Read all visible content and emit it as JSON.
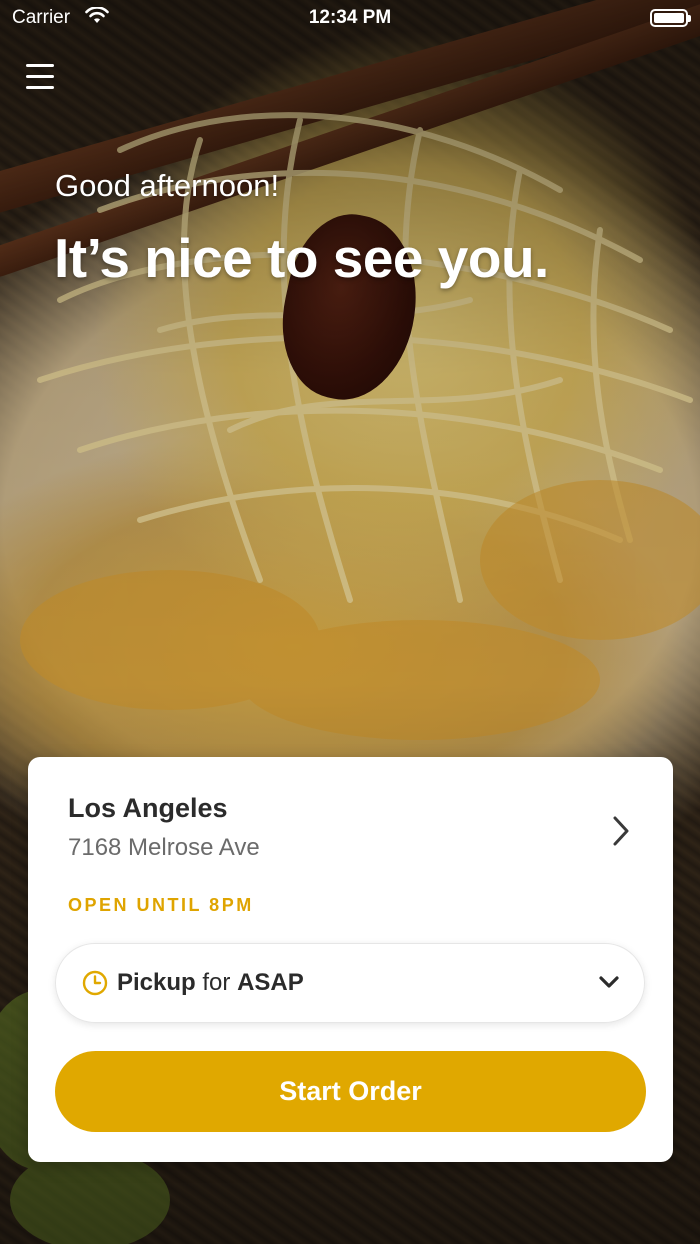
{
  "status_bar": {
    "carrier": "Carrier",
    "time": "12:34 PM"
  },
  "hero": {
    "greeting": "Good afternoon!",
    "headline": "It’s nice to see you."
  },
  "location": {
    "city": "Los Angeles",
    "address": "7168 Melrose Ave",
    "hours": "OPEN UNTIL 8PM"
  },
  "order_mode": {
    "mode": "Pickup",
    "connector": "for",
    "time": "ASAP"
  },
  "actions": {
    "start_order_label": "Start Order"
  },
  "colors": {
    "accent": "#e0a800",
    "hours_text": "#dfa400"
  },
  "icons": {
    "menu": "hamburger-menu-icon",
    "location_chevron": "chevron-right-icon",
    "clock": "clock-icon",
    "mode_chevron": "chevron-down-icon",
    "wifi": "wifi-icon",
    "battery": "battery-icon"
  }
}
